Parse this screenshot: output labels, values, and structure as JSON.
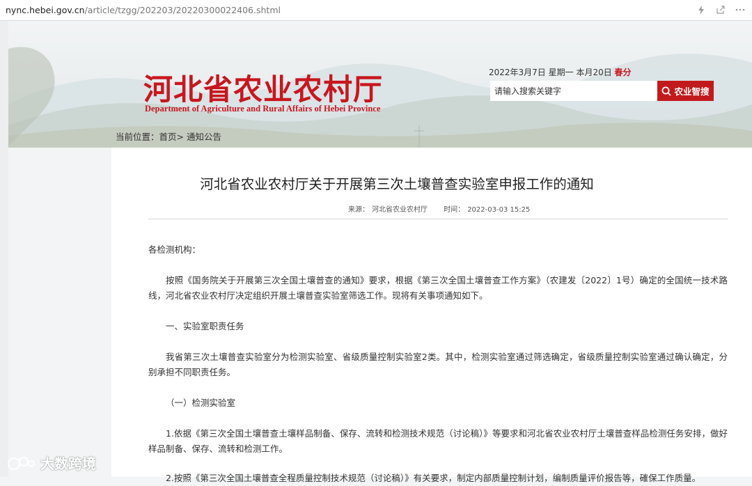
{
  "browser": {
    "url_host": "nync.hebei.gov.cn",
    "url_path": "/article/tzgg/202203/20220300022406.shtml"
  },
  "header": {
    "logo_cn": "河北省农业农村厅",
    "logo_en": "Department of  Agriculture and  Rural Affairs  of Hebei Province",
    "date_text": "2022年3月7日 星期一 本月20日 ",
    "season": "春分",
    "search_placeholder": "请输入搜索关键字",
    "search_button": "农业智搜"
  },
  "breadcrumb": {
    "prefix": "当前位置：",
    "home": "首页",
    "sep": "> ",
    "current": "通知公告"
  },
  "article": {
    "title": "河北省农业农村厅关于开展第三次土壤普查实验室申报工作的通知",
    "source_label": "来源：",
    "source": "河北省农业农村厅",
    "time_label": "时间：",
    "time": "2022-03-03 15:25",
    "salutation": "各检测机构：",
    "para1": "按照《国务院关于开展第三次全国土壤普查的通知》要求，根据《第三次全国土壤普查工作方案》（农建发〔2022〕1号）确定的全国统一技术路线，河北省农业农村厅决定组织开展土壤普查实验室筛选工作。现将有关事项通知如下。",
    "section1": "一、实验室职责任务",
    "para2": "我省第三次土壤普查实验室分为检测实验室、省级质量控制实验室2类。其中，检测实验室通过筛选确定，省级质量控制实验室通过确认确定，分别承担不同职责任务。",
    "sub1": "（一）检测实验室",
    "para3": "1.依据《第三次全国土壤普查土壤样品制备、保存、流转和检测技术规范（讨论稿）》等要求和河北省农业农村厅土壤普查样品检测任务安排，做好样品制备、保存、流转和检测工作。",
    "para4": "2.按照《第三次全国土壤普查全程质量控制技术规范（讨论稿）》有关要求，制定内部质量控制计划，编制质量评价报告等，確保工作质量。"
  },
  "watermark": {
    "text": "大数跨境"
  },
  "colors": {
    "brand_red": "#c8161e",
    "search_red": "#c21a1c"
  }
}
